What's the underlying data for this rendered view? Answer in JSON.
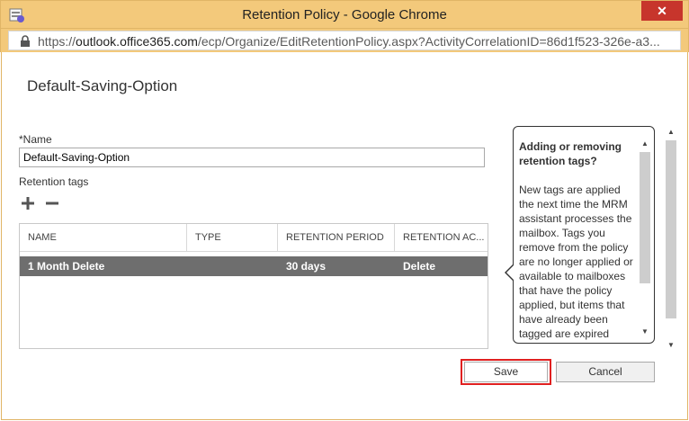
{
  "window": {
    "title": "Retention Policy - Google Chrome",
    "close_glyph": "✕"
  },
  "address_bar": {
    "protocol": "https://",
    "domain": "outlook.office365.com",
    "path": "/ecp/Organize/EditRetentionPolicy.aspx?ActivityCorrelationID=86d1f523-326e-a3..."
  },
  "page": {
    "title": "Default-Saving-Option"
  },
  "form": {
    "name_label": "*Name",
    "name_value": "Default-Saving-Option",
    "tags_label": "Retention tags",
    "add_icon": "plus-icon",
    "remove_icon": "minus-icon"
  },
  "table": {
    "columns": [
      "NAME",
      "TYPE",
      "RETENTION PERIOD",
      "RETENTION AC..."
    ],
    "rows": [
      {
        "name": "1 Month Delete",
        "type": "",
        "period": "30 days",
        "action": "Delete",
        "selected": true
      }
    ]
  },
  "tooltip": {
    "heading": "Adding or removing retention tags?",
    "body": "New tags are applied the next time the MRM assistant processes the mailbox. Tags you remove from the policy are no longer applied or available to mailboxes that have the policy applied, but items that have already been tagged are expired"
  },
  "buttons": {
    "save": "Save",
    "cancel": "Cancel"
  },
  "colors": {
    "frame": "#f3c97b",
    "close": "#c7352c",
    "selected_row": "#6e6e6e",
    "highlight": "#e02020"
  }
}
